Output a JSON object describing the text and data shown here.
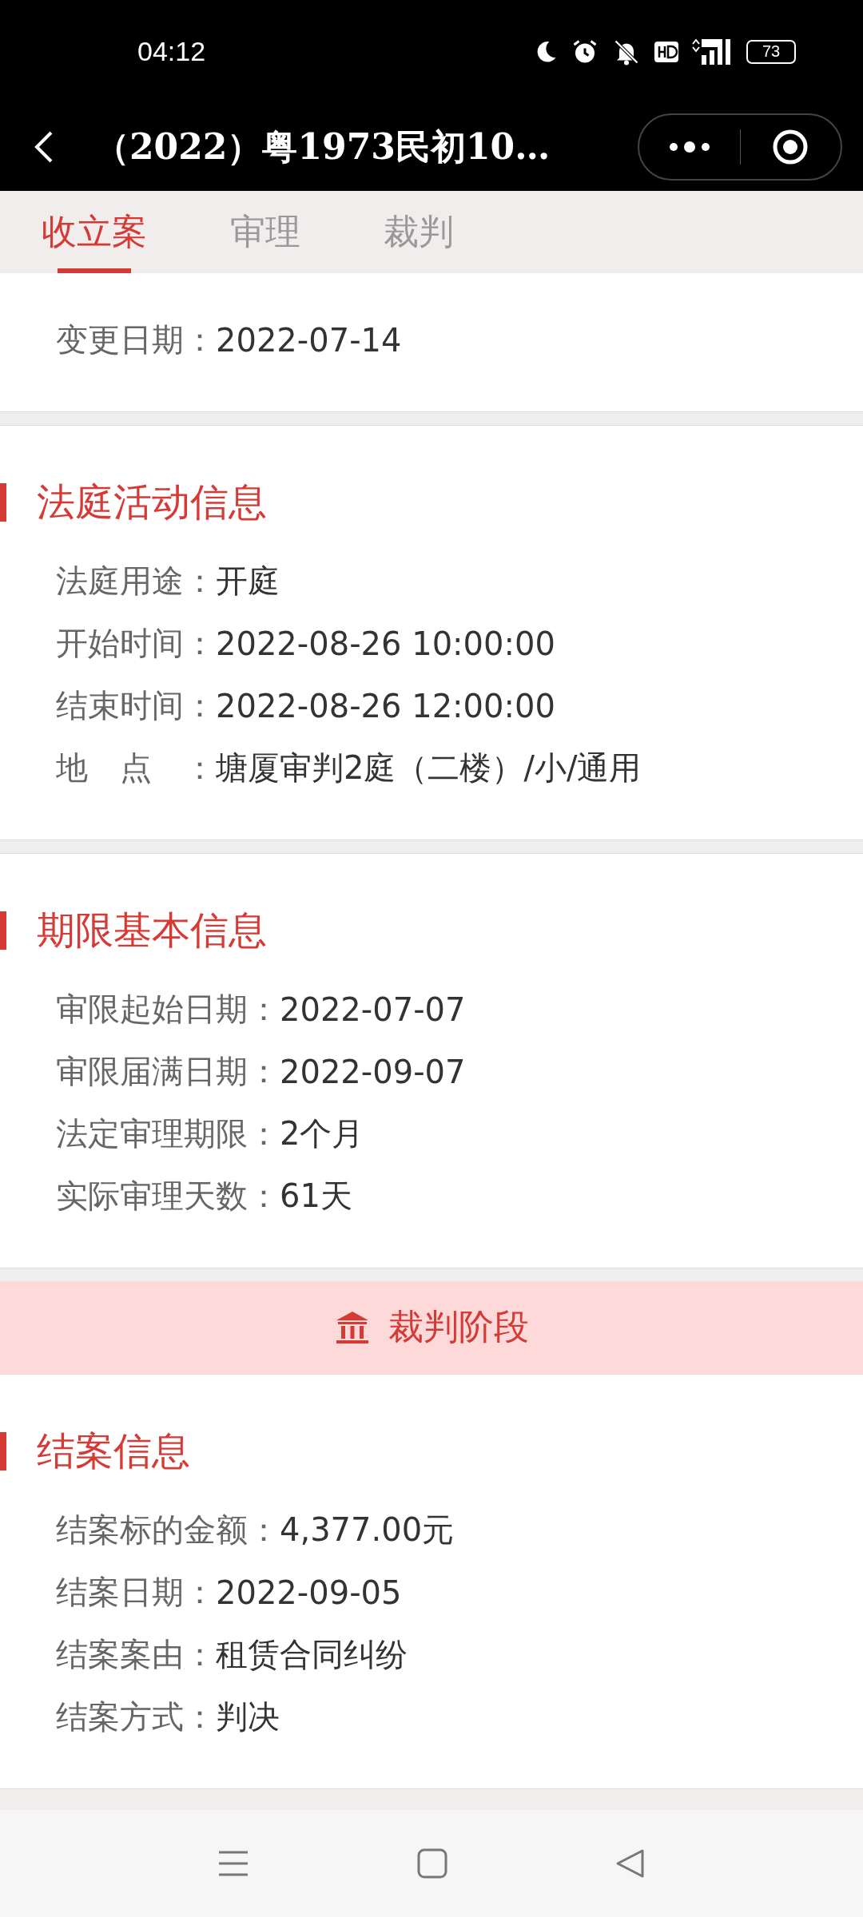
{
  "status_bar": {
    "time": "04:12",
    "battery": "73"
  },
  "header": {
    "title": "（2022）粤1973民初10…"
  },
  "tabs": [
    {
      "label": "收立案",
      "selected": true
    },
    {
      "label": "审理",
      "selected": false
    },
    {
      "label": "裁判",
      "selected": false
    }
  ],
  "sections": [
    {
      "kind": "card",
      "rows": [
        {
          "label": "变更日期：",
          "value": "2022-07-14"
        }
      ]
    },
    {
      "kind": "card",
      "title": "法庭活动信息",
      "rows": [
        {
          "label": "法庭用途：",
          "value": "开庭"
        },
        {
          "label": "开始时间：",
          "value": "2022-08-26 10:00:00"
        },
        {
          "label": "结束时间：",
          "value": "2022-08-26 12:00:00"
        },
        {
          "label": "地　点　：",
          "value": "塘厦审判2庭（二楼）/小/通用"
        }
      ]
    },
    {
      "kind": "card",
      "title": "期限基本信息",
      "rows": [
        {
          "label": "审限起始日期：",
          "value": "2022-07-07"
        },
        {
          "label": "审限届满日期：",
          "value": "2022-09-07"
        },
        {
          "label": "法定审理期限：",
          "value": "2个月"
        },
        {
          "label": "实际审理天数：",
          "value": "61天"
        }
      ]
    },
    {
      "kind": "banner",
      "title": "裁判阶段"
    },
    {
      "kind": "card",
      "title": "结案信息",
      "rows": [
        {
          "label": "结案标的金额：",
          "value": "4,377.00元"
        },
        {
          "label": "结案日期：",
          "value": "2022-09-05"
        },
        {
          "label": "结案案由：",
          "value": "租赁合同纠纷"
        },
        {
          "label": "结案方式：",
          "value": "判决"
        }
      ]
    }
  ]
}
